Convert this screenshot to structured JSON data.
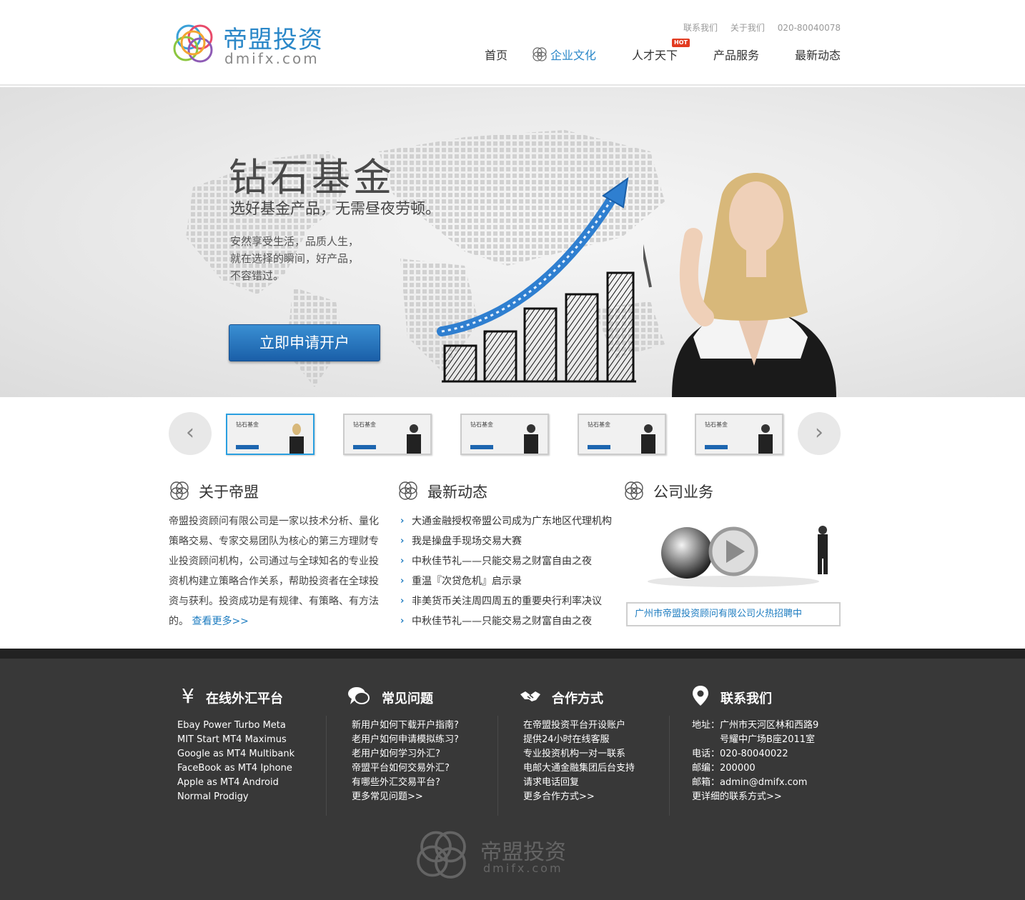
{
  "brand": {
    "name_cn": "帝盟投资",
    "name_en": "dmifx.com"
  },
  "toplinks": {
    "contact": "联系我们",
    "about": "关于我们",
    "phone": "020-80040078"
  },
  "nav": {
    "items": [
      {
        "label": "首页"
      },
      {
        "label": "企业文化"
      },
      {
        "label": "人才天下",
        "badge": "HOT"
      },
      {
        "label": "产品服务"
      },
      {
        "label": "最新动态"
      }
    ],
    "active": "企业文化"
  },
  "banner": {
    "title": "钻石基金",
    "subtitle": "选好基金产品，无需昼夜劳顿。",
    "desc": [
      "安然享受生活，品质人生，",
      "就在选择的瞬间，好产品，",
      "不容错过。"
    ],
    "button": "立即申请开户"
  },
  "thumbs": {
    "items": [
      {
        "label": "钻石基金"
      },
      {
        "label": "钻石基金"
      },
      {
        "label": "钻石基金"
      },
      {
        "label": "钻石基金"
      },
      {
        "label": "钻石基金"
      }
    ],
    "prev": "‹",
    "next": "›"
  },
  "about": {
    "title": "关于帝盟",
    "text": "帝盟投资顾问有限公司是一家以技术分析、量化策略交易、专家交易团队为核心的第三方理财专业投资顾问机构，公司通过与全球知名的专业投资机构建立策略合作关系，帮助投资者在全球投资与获利。投资成功是有规律、有策略、有方法的。",
    "more": "查看更多>>"
  },
  "news": {
    "title": "最新动态",
    "items": [
      "大通金融授权帝盟公司成为广东地区代理机构",
      "我是操盘手现场交易大赛",
      "中秋佳节礼——只能交易之财富自由之夜",
      "重温『次贷危机』启示录",
      "非美货币关注周四周五的重要央行利率决议",
      "中秋佳节礼——只能交易之财富自由之夜"
    ]
  },
  "business": {
    "title": "公司业务",
    "recruit": "广州市帝盟投资顾问有限公司火热招聘中"
  },
  "footer": {
    "platform": {
      "title": "在线外汇平台",
      "items": [
        "Ebay Power Turbo Meta",
        "MIT Start MT4 Maximus",
        "Google as MT4 Multibank",
        "FaceBook as MT4 Iphone",
        "Apple as MT4 Android",
        "Normal Prodigy"
      ]
    },
    "faq": {
      "title": "常见问题",
      "items": [
        "新用户如何下载开户指南?",
        "老用户如何申请模拟练习?",
        "老用户如何学习外汇?",
        "帝盟平台如何交易外汇?",
        "有哪些外汇交易平台?",
        "更多常见问题>>"
      ]
    },
    "coop": {
      "title": "合作方式",
      "items": [
        "在帝盟投资平台开设账户",
        "提供24小时在线客服",
        "专业投资机构一对一联系",
        "电邮大通金融集团后台支持",
        "请求电话回复",
        "更多合作方式>>"
      ]
    },
    "contact": {
      "title": "联系我们",
      "items": [
        "地址：广州市天河区林和西路9",
        "　　　号耀中广场B座2011室",
        "电话：020-80040022",
        "邮编：200000",
        "邮箱：admin@dmifx.com",
        "更详细的联系方式>>"
      ]
    }
  },
  "colors": {
    "accent": "#2a87c8",
    "link": "#1d7cc0",
    "footer_bg": "#383838",
    "hot": "#e23b20"
  }
}
